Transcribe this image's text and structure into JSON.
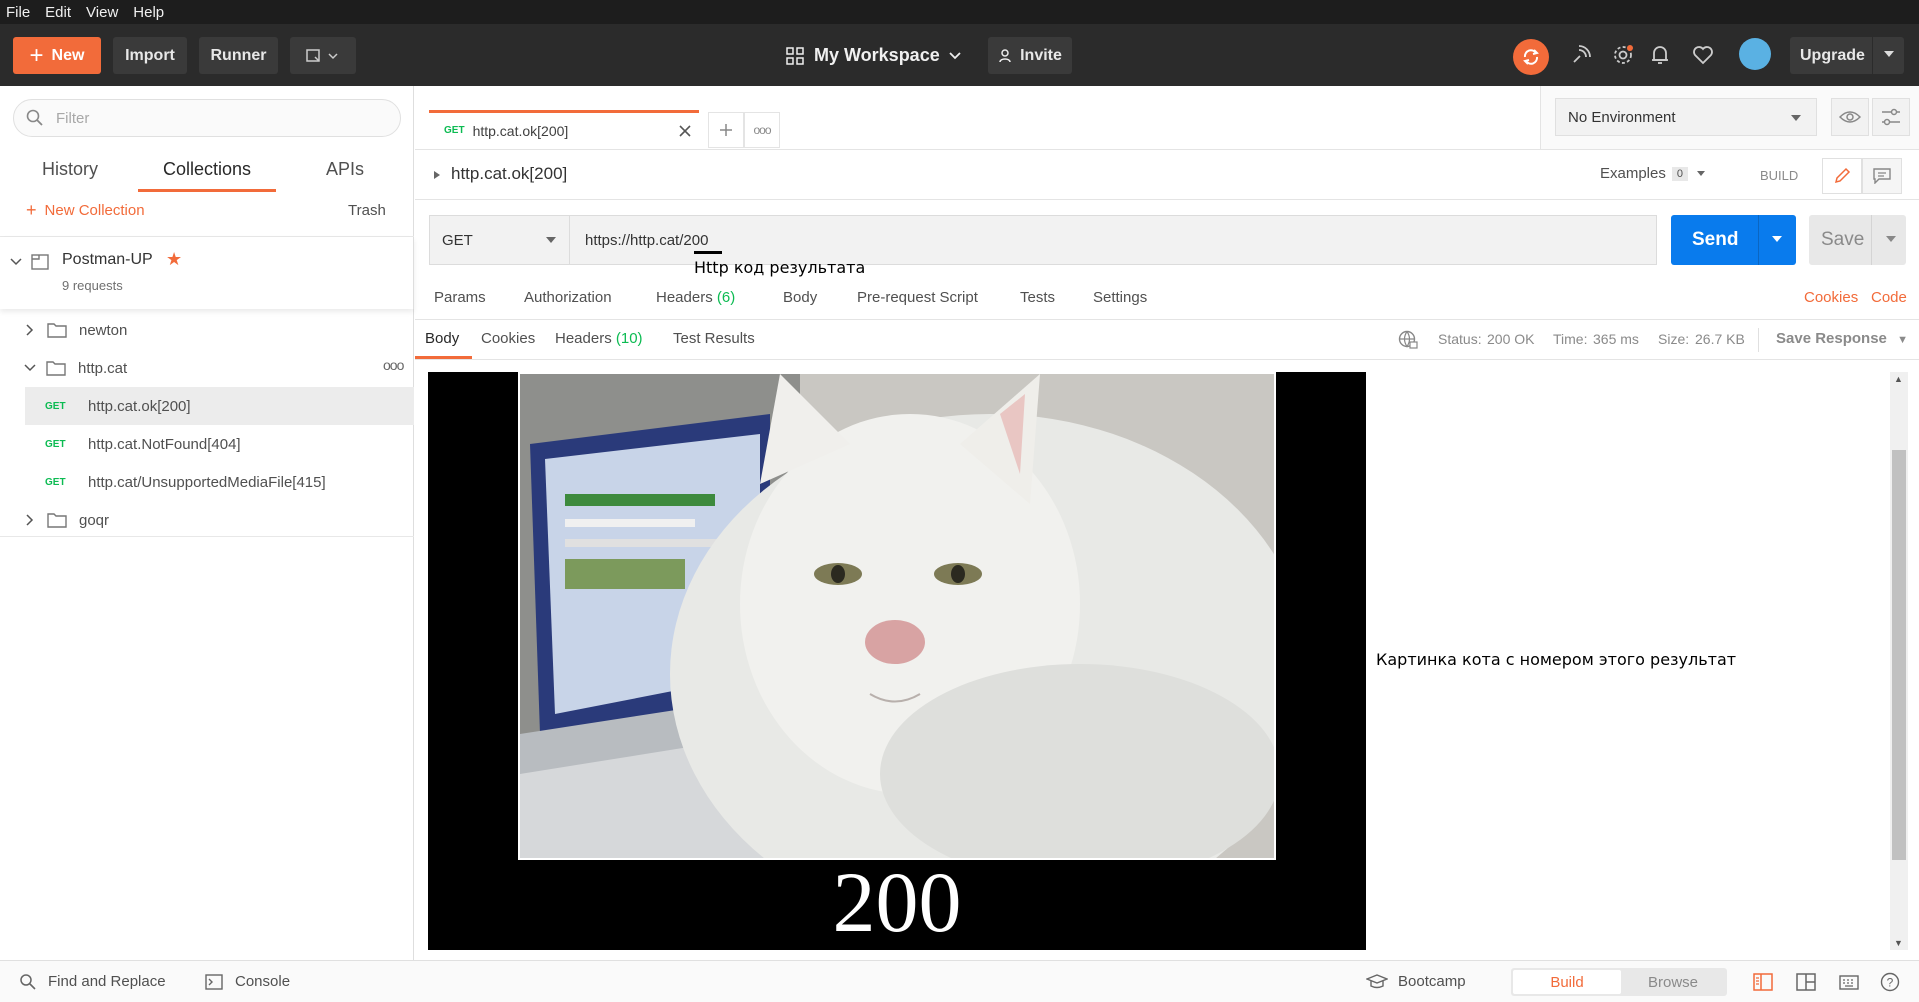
{
  "menu": [
    "File",
    "Edit",
    "View",
    "Help"
  ],
  "header": {
    "new_label": "New",
    "import_label": "Import",
    "runner_label": "Runner",
    "workspace": "My Workspace",
    "invite_label": "Invite",
    "upgrade_label": "Upgrade"
  },
  "sidebar": {
    "filter_placeholder": "Filter",
    "tabs": [
      "History",
      "Collections",
      "APIs"
    ],
    "active_tab": "Collections",
    "new_collection": "New Collection",
    "trash": "Trash",
    "collection": {
      "name": "Postman-UP",
      "count": "9 requests"
    },
    "folders": [
      "newton",
      "http.cat",
      "goqr"
    ],
    "requests": [
      {
        "method": "GET",
        "name": "http.cat.ok[200]"
      },
      {
        "method": "GET",
        "name": "http.cat.NotFound[404]"
      },
      {
        "method": "GET",
        "name": "http.cat/UnsupportedMediaFile[415]"
      }
    ]
  },
  "tab": {
    "method": "GET",
    "name": "http.cat.ok[200]"
  },
  "environment": "No Environment",
  "request": {
    "name": "http.cat.ok[200]",
    "examples_label": "Examples",
    "examples_count": "0",
    "build_label": "BUILD",
    "method": "GET",
    "url": "https://http.cat/200",
    "send_label": "Send",
    "save_label": "Save"
  },
  "annotations": {
    "url_note": "Http код результата",
    "image_note": "Картинка кота с номером этого результат"
  },
  "request_tabs": {
    "params": "Params",
    "authorization": "Authorization",
    "headers": "Headers",
    "headers_count": "(6)",
    "body": "Body",
    "prerequest": "Pre-request Script",
    "tests": "Tests",
    "settings": "Settings",
    "cookies": "Cookies",
    "code": "Code"
  },
  "response": {
    "tabs": {
      "body": "Body",
      "cookies": "Cookies",
      "headers": "Headers",
      "headers_count": "(10)",
      "test_results": "Test Results"
    },
    "status_label": "Status:",
    "status_value": "200 OK",
    "time_label": "Time:",
    "time_value": "365 ms",
    "size_label": "Size:",
    "size_value": "26.7 KB",
    "save_response": "Save Response",
    "image_caption": "200"
  },
  "footer": {
    "find_replace": "Find and Replace",
    "console": "Console",
    "bootcamp": "Bootcamp",
    "build": "Build",
    "browse": "Browse"
  },
  "colors": {
    "accent": "#f26b3a",
    "send": "#097bed",
    "get_method": "#0cbb52",
    "header_bg": "#2b2b2b"
  }
}
